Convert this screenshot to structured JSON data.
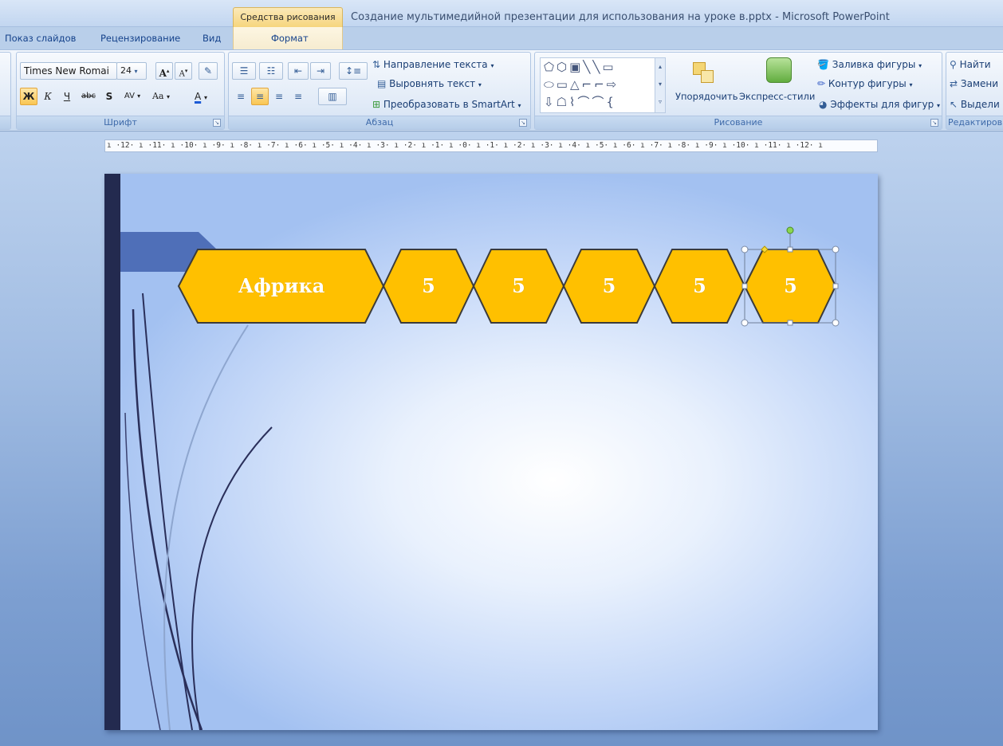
{
  "titlebar": {
    "context_tab": "Средства рисования",
    "window_title": "Создание мультимедийной презентации для использования на уроке в.pptx - Microsoft PowerPoint"
  },
  "tabs": {
    "slideshow": "Показ слайдов",
    "review": "Рецензирование",
    "view": "Вид",
    "format": "Формат"
  },
  "font_group": {
    "label": "Шрифт",
    "font_name": "Times New Romai",
    "font_size": "24",
    "grow": "A",
    "shrink": "A",
    "bold": "Ж",
    "italic": "К",
    "underline": "Ч",
    "strike": "abc",
    "shadow": "S",
    "spacing": "AV",
    "case": "Aa",
    "color": "A"
  },
  "paragraph_group": {
    "label": "Абзац",
    "text_direction": "Направление текста",
    "align_text": "Выровнять текст",
    "smartart": "Преобразовать в SmartArt"
  },
  "drawing_group": {
    "label": "Рисование",
    "arrange": "Упорядочить",
    "quick_styles": "Экспресс-стили",
    "shape_fill": "Заливка фигуры",
    "shape_outline": "Контур фигуры",
    "shape_effects": "Эффекты для фигур"
  },
  "editing_group": {
    "label": "Редактиров",
    "find": "Найти",
    "replace": "Замени",
    "select": "Выдели"
  },
  "ruler": {
    "text": "ı ·12· ı ·11· ı ·10· ı ·9· ı ·8· ı ·7· ı ·6· ı ·5· ı ·4· ı ·3· ı ·2· ı ·1· ı ·0· ı ·1· ı ·2· ı ·3· ı ·4· ı ·5· ı ·6· ı ·7· ı ·8· ı ·9· ı ·10· ı ·11· ı ·12· ı"
  },
  "slide": {
    "shapes": [
      "Африка",
      "5",
      "5",
      "5",
      "5",
      "5"
    ],
    "colors": {
      "hex_fill": "#FFC000",
      "hex_stroke": "#3b3b3b",
      "side_bar": "#232A4F",
      "tab_shape": "#4f6fb8"
    }
  }
}
